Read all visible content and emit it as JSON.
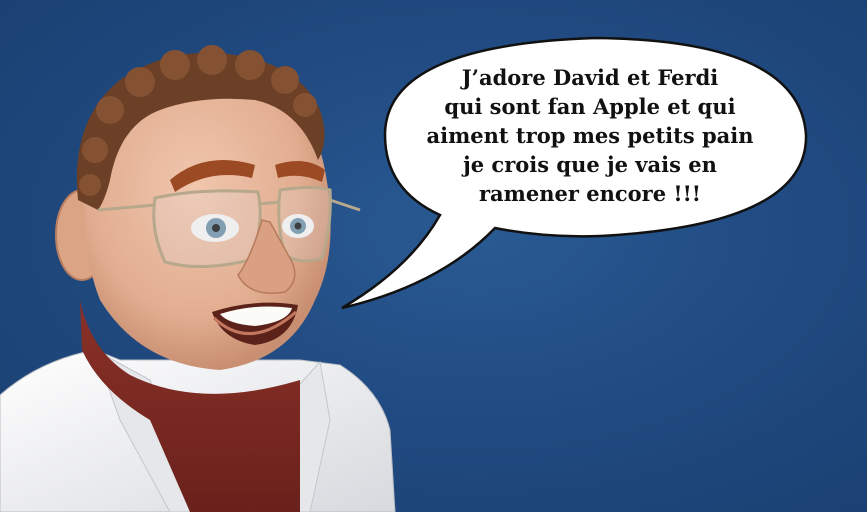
{
  "speech_bubble": {
    "lines": [
      "J’adore David et Ferdi",
      "qui sont fan Apple et qui",
      "aiment trop mes petits pain",
      "je crois que je vais en",
      "ramener encore !!!"
    ]
  },
  "colors": {
    "background": "#214b82",
    "skin": "#e8b79c",
    "hair": "#6b4026",
    "sweater": "#7a2a22",
    "coat": "#f1f1f1"
  }
}
